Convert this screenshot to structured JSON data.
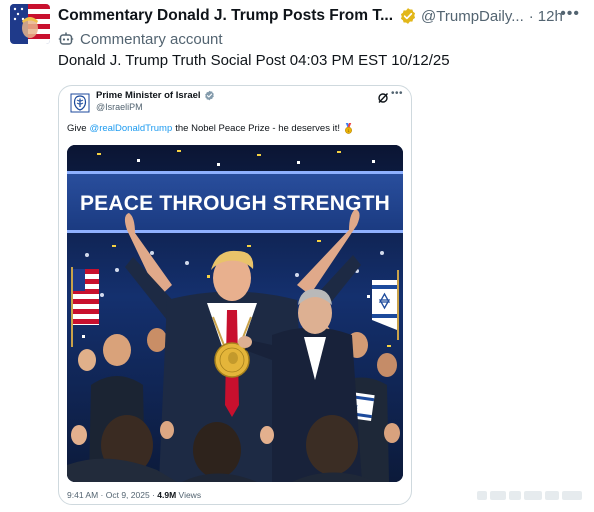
{
  "post": {
    "display_name": "Commentary Donald J. Trump Posts From T...",
    "handle": "@TrumpDaily...",
    "separator": "·",
    "time": "12h",
    "more_icon": "more-horizontal-icon",
    "label": "Commentary account",
    "label_icon": "automated-account-icon",
    "text": "Donald J. Trump Truth Social Post 04:03 PM EST 10/12/25",
    "verified_color": "#e2b719"
  },
  "quoted": {
    "name": "Prime Minister of Israel",
    "handle": "@IsraeliPM",
    "text_before": "Give",
    "mention": "@realDonaldTrump",
    "text_after": "the Nobel Peace Prize - he deserves it!",
    "medal_icon": "medal-icon",
    "image": {
      "banner": "PEACE THROUGH STRENGTH",
      "description_icon": "photo"
    },
    "time": "9:41 AM · Oct 9, 2025 ·",
    "views": "4.9M",
    "views_label": "Views",
    "verified_color": "#829aab",
    "link_color": "#1d9bf0"
  }
}
